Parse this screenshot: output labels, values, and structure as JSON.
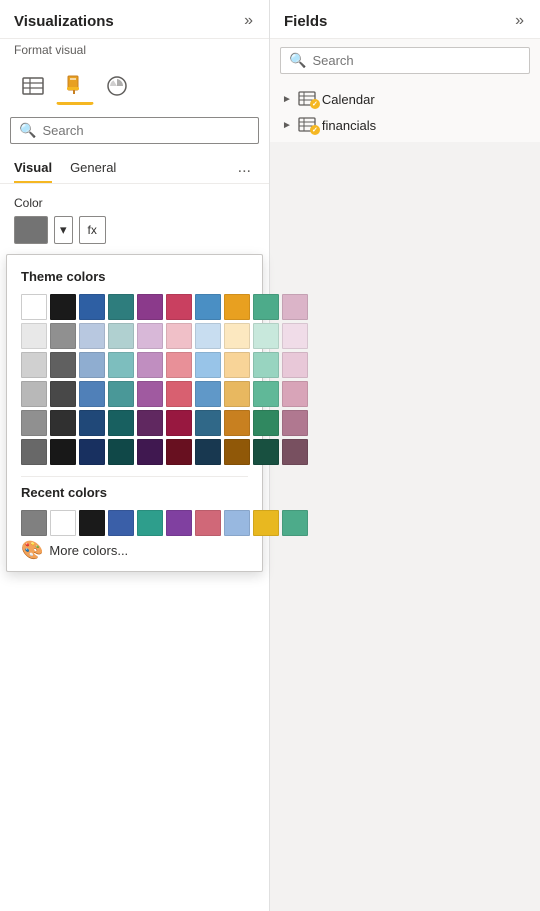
{
  "left_panel": {
    "title": "Visualizations",
    "format_visual_label": "Format visual",
    "search_placeholder": "Search",
    "tabs": [
      {
        "label": "Visual",
        "active": true
      },
      {
        "label": "General",
        "active": false
      }
    ],
    "tabs_more": "...",
    "color_label": "Color",
    "color_swatch": "#737373",
    "dropdown_label": "▾",
    "fx_label": "fx",
    "theme_colors_title": "Theme colors",
    "theme_colors_row1": [
      "#ffffff",
      "#1a1a1a",
      "#2e5fa3",
      "#2e7d7d",
      "#8b3a8b",
      "#c94060",
      "#4a8fc4",
      "#e8a020",
      "#4dab8a",
      "#dbb4c8"
    ],
    "theme_colors_row2": [
      "#e8e8e8",
      "#808080",
      "#b8c8e0",
      "#b0d0d0",
      "#d8b8d8",
      "#f0c0c8",
      "#c8ddf0",
      "#fce8c0",
      "#c8e8dc",
      "#f0dce8"
    ],
    "theme_colors_row3": [
      "#d0d0d0",
      "#606060",
      "#8fadd0",
      "#7dbebe",
      "#c08ec0",
      "#e89098",
      "#98c4e8",
      "#f8d498",
      "#98d4c0",
      "#e8c8d8"
    ],
    "theme_colors_row4": [
      "#b8b8b8",
      "#484848",
      "#5080b8",
      "#4a9898",
      "#a05aa0",
      "#d86070",
      "#6098c8",
      "#e8b860",
      "#60b898",
      "#d8a4b8"
    ],
    "theme_colors_row5": [
      "#909090",
      "#303030",
      "#204878",
      "#186060",
      "#602860",
      "#981840",
      "#306888",
      "#c88020",
      "#308860",
      "#b07890"
    ],
    "theme_colors_row6": [
      "#686868",
      "#181818",
      "#183060",
      "#104848",
      "#401850",
      "#681020",
      "#183850",
      "#905808",
      "#185040",
      "#785060"
    ],
    "recent_colors_title": "Recent colors",
    "recent_colors": [
      "#808080",
      "#ffffff",
      "#1a1a1a",
      "#3a5fa8",
      "#2e9e8c",
      "#8040a0",
      "#d06878",
      "#98b8e0",
      "#e8b820",
      "#4dab8a"
    ],
    "more_colors_label": "More colors..."
  },
  "right_panel": {
    "title": "Fields",
    "search_placeholder": "Search",
    "fields": [
      {
        "name": "Calendar",
        "has_badge": true
      },
      {
        "name": "financials",
        "has_badge": true
      }
    ]
  }
}
